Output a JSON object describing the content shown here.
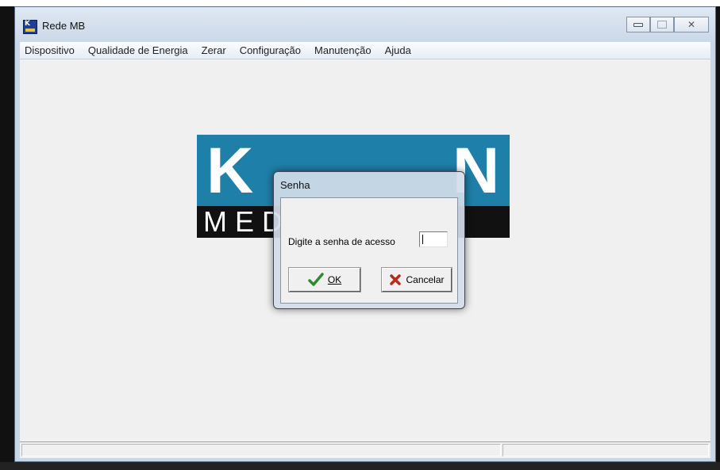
{
  "window": {
    "title": "Rede MB"
  },
  "menu": {
    "items": [
      "Dispositivo",
      "Qualidade de Energia",
      "Zerar",
      "Configuração",
      "Manutenção",
      "Ajuda"
    ]
  },
  "logo": {
    "top_letters": [
      "K",
      "N"
    ],
    "bottom_word": "MEDIDORES"
  },
  "dialog": {
    "title": "Senha",
    "prompt": "Digite a senha de acesso",
    "password_value": "",
    "ok_label": "OK",
    "cancel_label": "Cancelar"
  },
  "colors": {
    "logo_blue": "#1e7fa8",
    "logo_black": "#111111",
    "ok_check": "#2e8b2e",
    "cancel_x": "#c0281c"
  },
  "icons": {
    "app": "kron-app-icon",
    "ok": "check-icon",
    "cancel": "x-icon"
  }
}
